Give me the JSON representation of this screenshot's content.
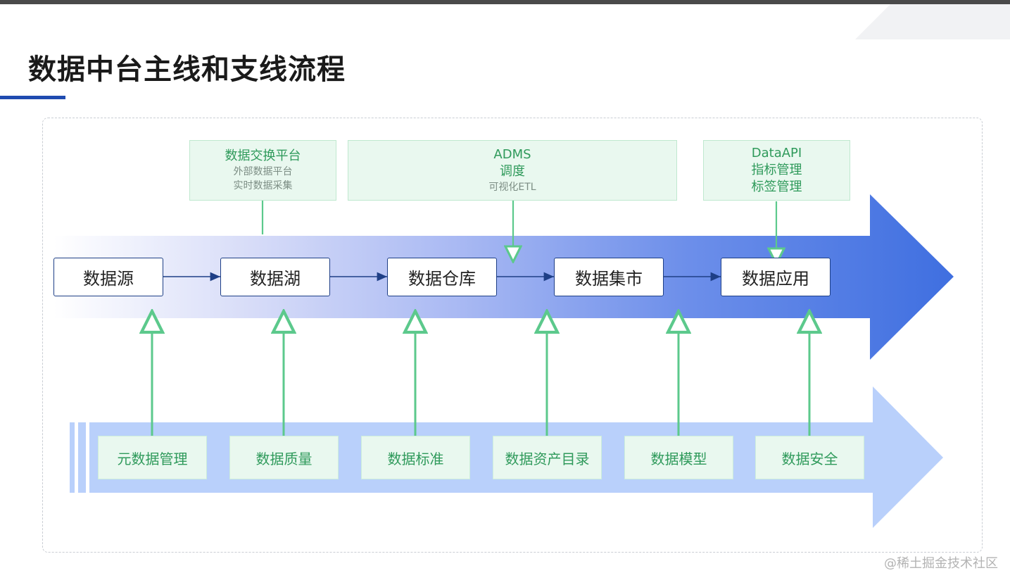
{
  "title": "数据中台主线和支线流程",
  "top_boxes": [
    {
      "main": [
        "数据交换平台"
      ],
      "sub": [
        "外部数据平台",
        "实时数据采集"
      ]
    },
    {
      "main": [
        "ADMS",
        "调度"
      ],
      "sub": [
        "可视化ETL"
      ]
    },
    {
      "main": [
        "DataAPI",
        "指标管理",
        "标签管理"
      ],
      "sub": []
    }
  ],
  "main_flow": [
    "数据源",
    "数据湖",
    "数据仓库",
    "数据集市",
    "数据应用"
  ],
  "support_items": [
    "元数据管理",
    "数据质量",
    "数据标准",
    "数据资产目录",
    "数据模型",
    "数据安全"
  ],
  "watermark": "@稀土掘金技术社区",
  "colors": {
    "main_arrow_start": "#ffffff",
    "main_arrow_end": "#3f6fe0",
    "support_arrow": "#b9d0fb",
    "node_border": "#1e3f86",
    "connector_green": "#5cc98c",
    "box_fill_green": "#e9f8ef",
    "text_green": "#2f9a5b",
    "title_accent": "#1f4bb0"
  }
}
